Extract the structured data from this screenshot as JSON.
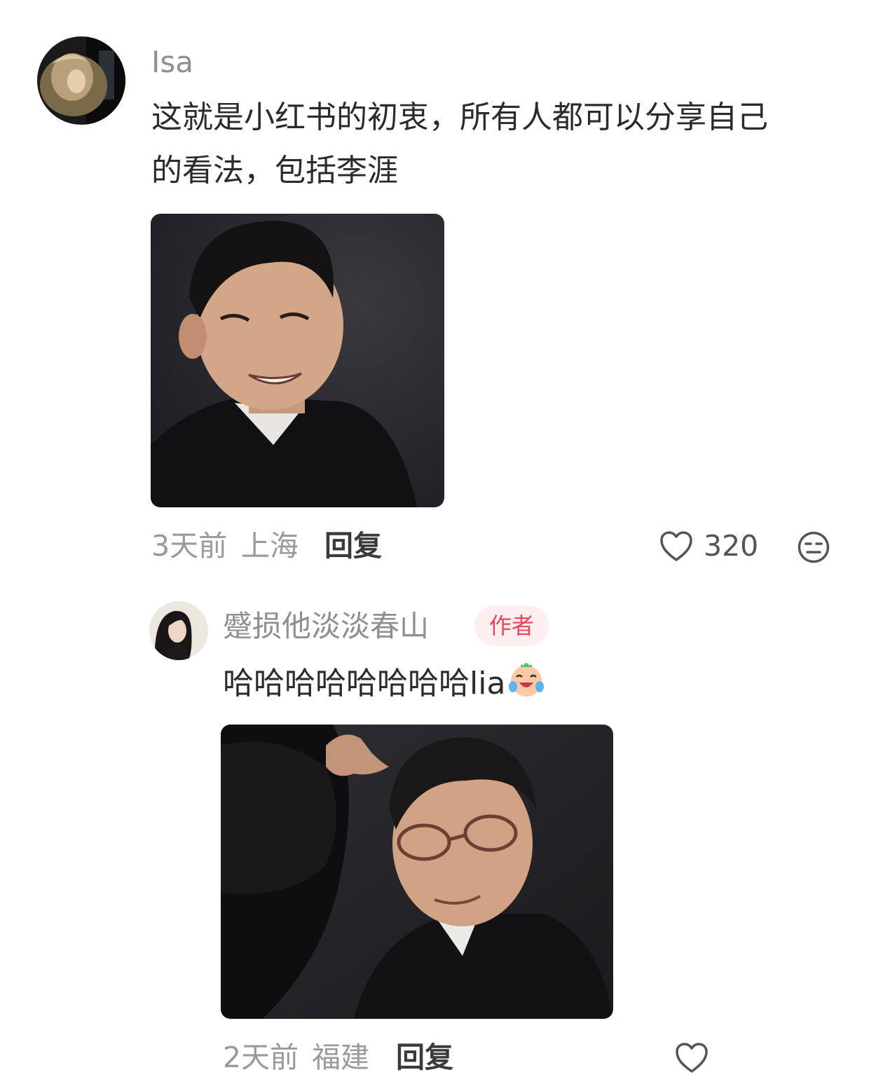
{
  "comments": [
    {
      "username": "Isa",
      "text_line1": "这就是小红书的初衷，所有人都可以分享自己",
      "text_line2": "的看法，包括李涯",
      "time": "3天前",
      "location": "上海",
      "reply_label": "回复",
      "like_count": "320",
      "like_icon": "heart-outline-icon",
      "dislike_icon": "meh-face-icon"
    },
    {
      "username": "蹙损他淡淡春山",
      "badge": "作者",
      "text": "哈哈哈哈哈哈哈哈lia",
      "emoji_icon": "laughing-crying-face-icon",
      "time": "2天前",
      "location": "福建",
      "reply_label": "回复",
      "like_icon": "heart-outline-icon"
    }
  ],
  "colors": {
    "badge_text": "#e8475a",
    "badge_bg": "#fdeef0",
    "username": "#8f8f8f",
    "meta": "#9a9a9a"
  }
}
